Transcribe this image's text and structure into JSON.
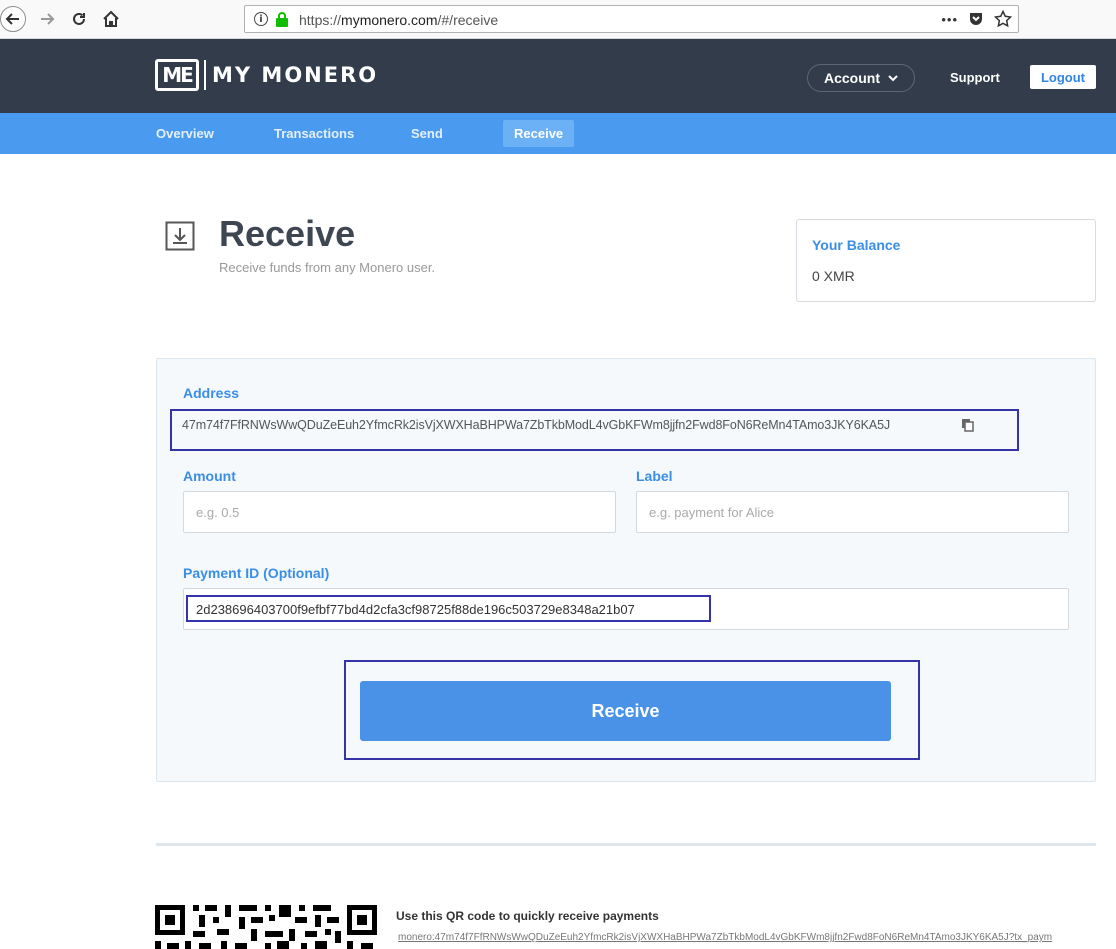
{
  "browser": {
    "url_prefix": "https://",
    "url_domain": "mymonero.com",
    "url_path": "/#/receive",
    "more_label": "•••"
  },
  "header": {
    "logo_mark": "ME",
    "logo_text": "MY MONERO",
    "account_label": "Account",
    "support_label": "Support",
    "logout_label": "Logout"
  },
  "nav": {
    "tabs": [
      {
        "label": "Overview"
      },
      {
        "label": "Transactions"
      },
      {
        "label": "Send"
      },
      {
        "label": "Receive",
        "active": true
      }
    ]
  },
  "page": {
    "title": "Receive",
    "subtitle": "Receive funds from any Monero user."
  },
  "balance": {
    "title": "Your Balance",
    "value": "0 XMR"
  },
  "form": {
    "address_label": "Address",
    "address_value": "47m74f7FfRNWsWwQDuZeEuh2YfmcRk2isVjXWXHaBHPWa7ZbTkbModL4vGbKFWm8jjfn2Fwd8FoN6ReMn4TAmo3JKY6KA5J",
    "amount_label": "Amount",
    "amount_placeholder": "e.g. 0.5",
    "label_label": "Label",
    "label_placeholder": "e.g. payment for Alice",
    "payment_id_label": "Payment ID (Optional)",
    "payment_id_value": "2d238696403700f9efbf77bd4d2cfa3cf98725f88de196c503729e8348a21b07",
    "submit_label": "Receive"
  },
  "qr": {
    "caption": "Use this QR code to quickly receive payments",
    "uri": "monero:47m74f7FfRNWsWwQDuZeEuh2YfmcRk2isVjXWXHaBHPWa7ZbTkbModL4vGbKFWm8jjfn2Fwd8FoN6ReMn4TAmo3JKY6KA5J?tx_paym"
  },
  "colors": {
    "header_bg": "#333c4a",
    "nav_bg": "#4a9af0",
    "accent": "#3a8ee6",
    "button": "#4a92e8",
    "highlight_box": "#3434a8"
  },
  "icons": {
    "back": "arrow-left-icon",
    "forward": "arrow-right-icon",
    "reload": "reload-icon",
    "home": "home-icon",
    "info": "info-icon",
    "lock": "lock-icon",
    "pocket": "pocket-icon",
    "star": "star-icon",
    "receive": "download-tray-icon",
    "copy": "copy-icon"
  }
}
